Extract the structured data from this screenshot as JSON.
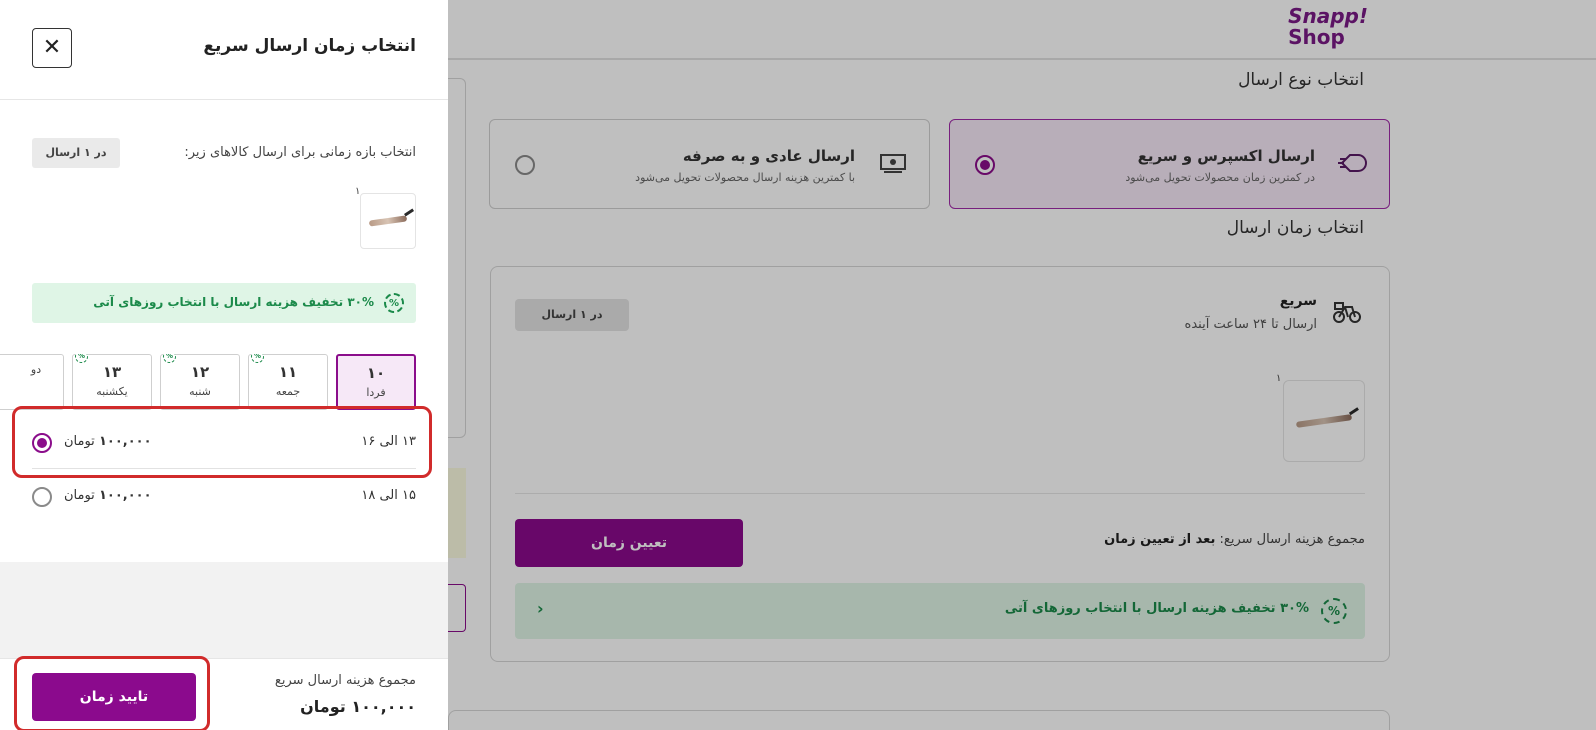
{
  "brand": {
    "logo_line1": "Snapp!",
    "logo_line2": "Shop"
  },
  "background": {
    "delivery_type_title": "انتخاب نوع ارسال",
    "delivery_types": [
      {
        "title": "ارسال اکسپرس و سریع",
        "subtitle": "در کمترین زمان محصولات تحویل می‌شود",
        "icon": "express-delivery-icon",
        "selected": true
      },
      {
        "title": "ارسال عادی و به صرفه",
        "subtitle": "با کمترین هزینه ارسال محصولات تحویل می‌شود",
        "icon": "money-icon",
        "selected": false
      }
    ],
    "time_title": "انتخاب زمان ارسال",
    "fast_card": {
      "title": "سریع",
      "subtitle": "ارسال تا ۲۴ ساعت آینده",
      "badge": "در ۱ ارسال",
      "product_qty": "۱",
      "total_label": "مجموع هزینه ارسال سریع:",
      "total_value": "بعد از تعیین زمان",
      "button": "تعیین زمان",
      "promo": "۳۰% تخفیف هزینه ارسال با انتخاب روزهای آتی"
    }
  },
  "drawer": {
    "title": "انتخاب زمان ارسال سریع",
    "close_symbol": "✕",
    "intro": "انتخاب بازه زمانی برای ارسال کالاهای زیر:",
    "badge": "در ۱ ارسال",
    "product_qty": "۱",
    "promo_icon": "%",
    "promo": "۳۰% تخفیف هزینه ارسال با انتخاب روزهای آتی",
    "days": [
      {
        "num": "۱۰",
        "label": "فردا",
        "selected": true,
        "discount": false
      },
      {
        "num": "۱۱",
        "label": "جمعه",
        "selected": false,
        "discount": true
      },
      {
        "num": "۱۲",
        "label": "شنبه",
        "selected": false,
        "discount": true
      },
      {
        "num": "۱۳",
        "label": "یکشنبه",
        "selected": false,
        "discount": true
      },
      {
        "num": "",
        "label": "دو",
        "selected": false,
        "discount": false
      }
    ],
    "slots": [
      {
        "time": "۱۳ الی ۱۶",
        "price": "۱۰۰,۰۰۰",
        "unit": "تومان",
        "selected": true
      },
      {
        "time": "۱۵ الی ۱۸",
        "price": "۱۰۰,۰۰۰",
        "unit": "تومان",
        "selected": false
      }
    ],
    "footer": {
      "total_label": "مجموع هزینه ارسال سریع",
      "total_amount": "۱۰۰,۰۰۰ تومان",
      "confirm_button": "تایید زمان"
    }
  },
  "colors": {
    "accent": "#8b0a8d",
    "promo_bg": "#dff5e6",
    "promo_text": "#1b8a4a",
    "annotation": "#d12b2b"
  }
}
